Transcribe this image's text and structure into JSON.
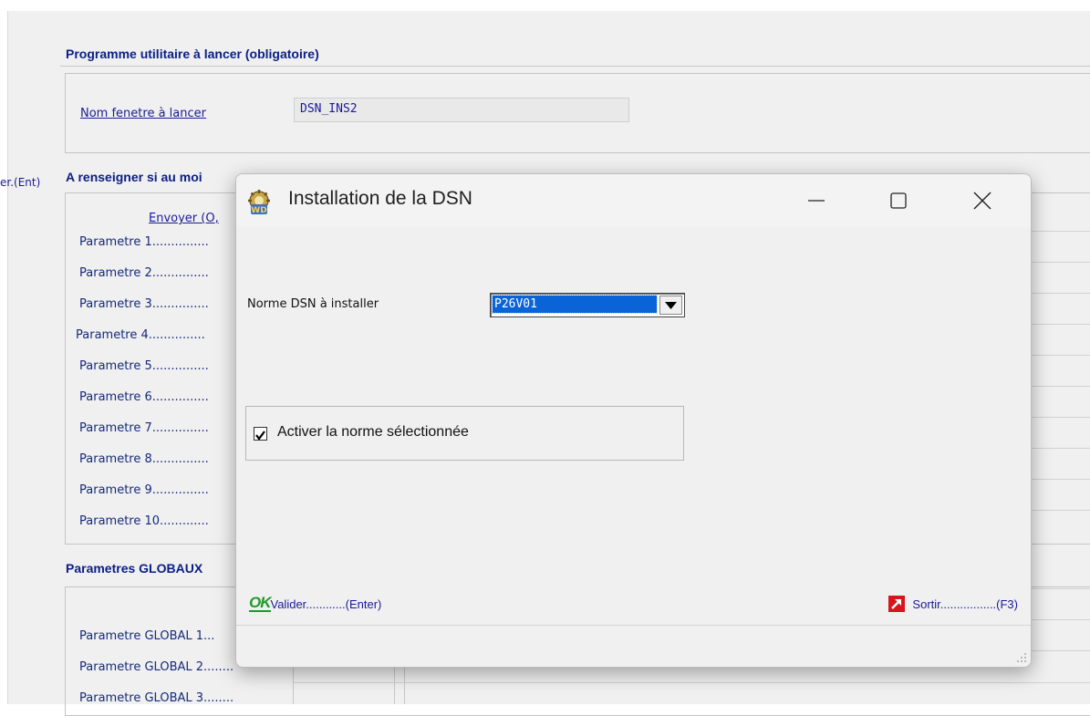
{
  "background": {
    "left_cut_label": "er.(Ent)",
    "section1": {
      "title": "Programme utilitaire à lancer  (obligatoire)",
      "field_label": "Nom fenetre à lancer",
      "field_value": "DSN_INS2"
    },
    "section2": {
      "title": "A renseigner si au moi",
      "column_header": "Envoyer (O,",
      "params": [
        "Parametre 1...............",
        "Parametre 2...............",
        "Parametre 3...............",
        "Parametre 4...............",
        "Parametre 5...............",
        "Parametre 6...............",
        "Parametre 7...............",
        "Parametre 8...............",
        "Parametre 9...............",
        "Parametre 10............."
      ]
    },
    "section3": {
      "title": "Parametres GLOBAUX",
      "params": [
        "Parametre GLOBAL 1...",
        "Parametre GLOBAL 2........",
        "Parametre GLOBAL 3........"
      ]
    }
  },
  "dialog": {
    "title": "Installation de la DSN",
    "icon": "windev-app-icon",
    "norme_label": "Norme DSN à installer",
    "norme_value": "P26V01",
    "checkbox_label": "Activer la norme sélectionnée",
    "checkbox_checked": true,
    "ok_glyph": "OK",
    "validate_label": "Valider............(Enter)",
    "exit_label": "Sortir.................(F3)",
    "colors": {
      "title_blue": "#0b1e86",
      "selection_blue": "#0a64d8",
      "ok_green": "#1f9a28",
      "exit_red": "#d8141c"
    }
  }
}
